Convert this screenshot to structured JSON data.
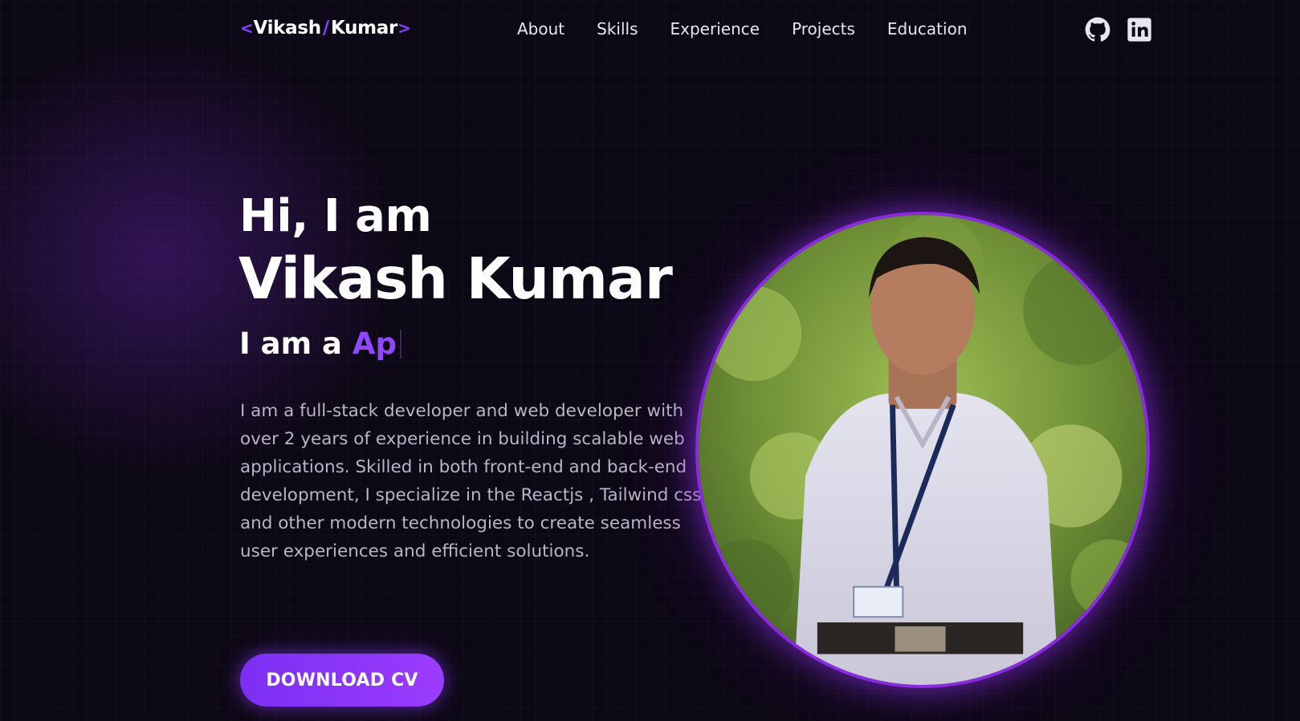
{
  "header": {
    "logo": {
      "first": "Vikash",
      "slash": "/",
      "last": "Kumar",
      "open": "<",
      "close": ">"
    },
    "nav": [
      "About",
      "Skills",
      "Experience",
      "Projects",
      "Education"
    ],
    "social": [
      {
        "icon": "github-icon"
      },
      {
        "icon": "linkedin-icon"
      }
    ]
  },
  "hero": {
    "greeting": "Hi, I am",
    "name": "Vikash Kumar",
    "role_prefix": "I am a ",
    "role_typed": "Ap",
    "bio": "I am a full-stack developer and web developer with over 2 years of experience in building scalable web applications. Skilled in both front-end and back-end development, I specialize in the Reactjs , Tailwind css and other modern technologies to create seamless user experiences and efficient solutions.",
    "cta_label": "DOWNLOAD CV"
  },
  "colors": {
    "accent": "#8a2be2",
    "background": "#0d0816",
    "body_text": "#b9b5c6"
  }
}
